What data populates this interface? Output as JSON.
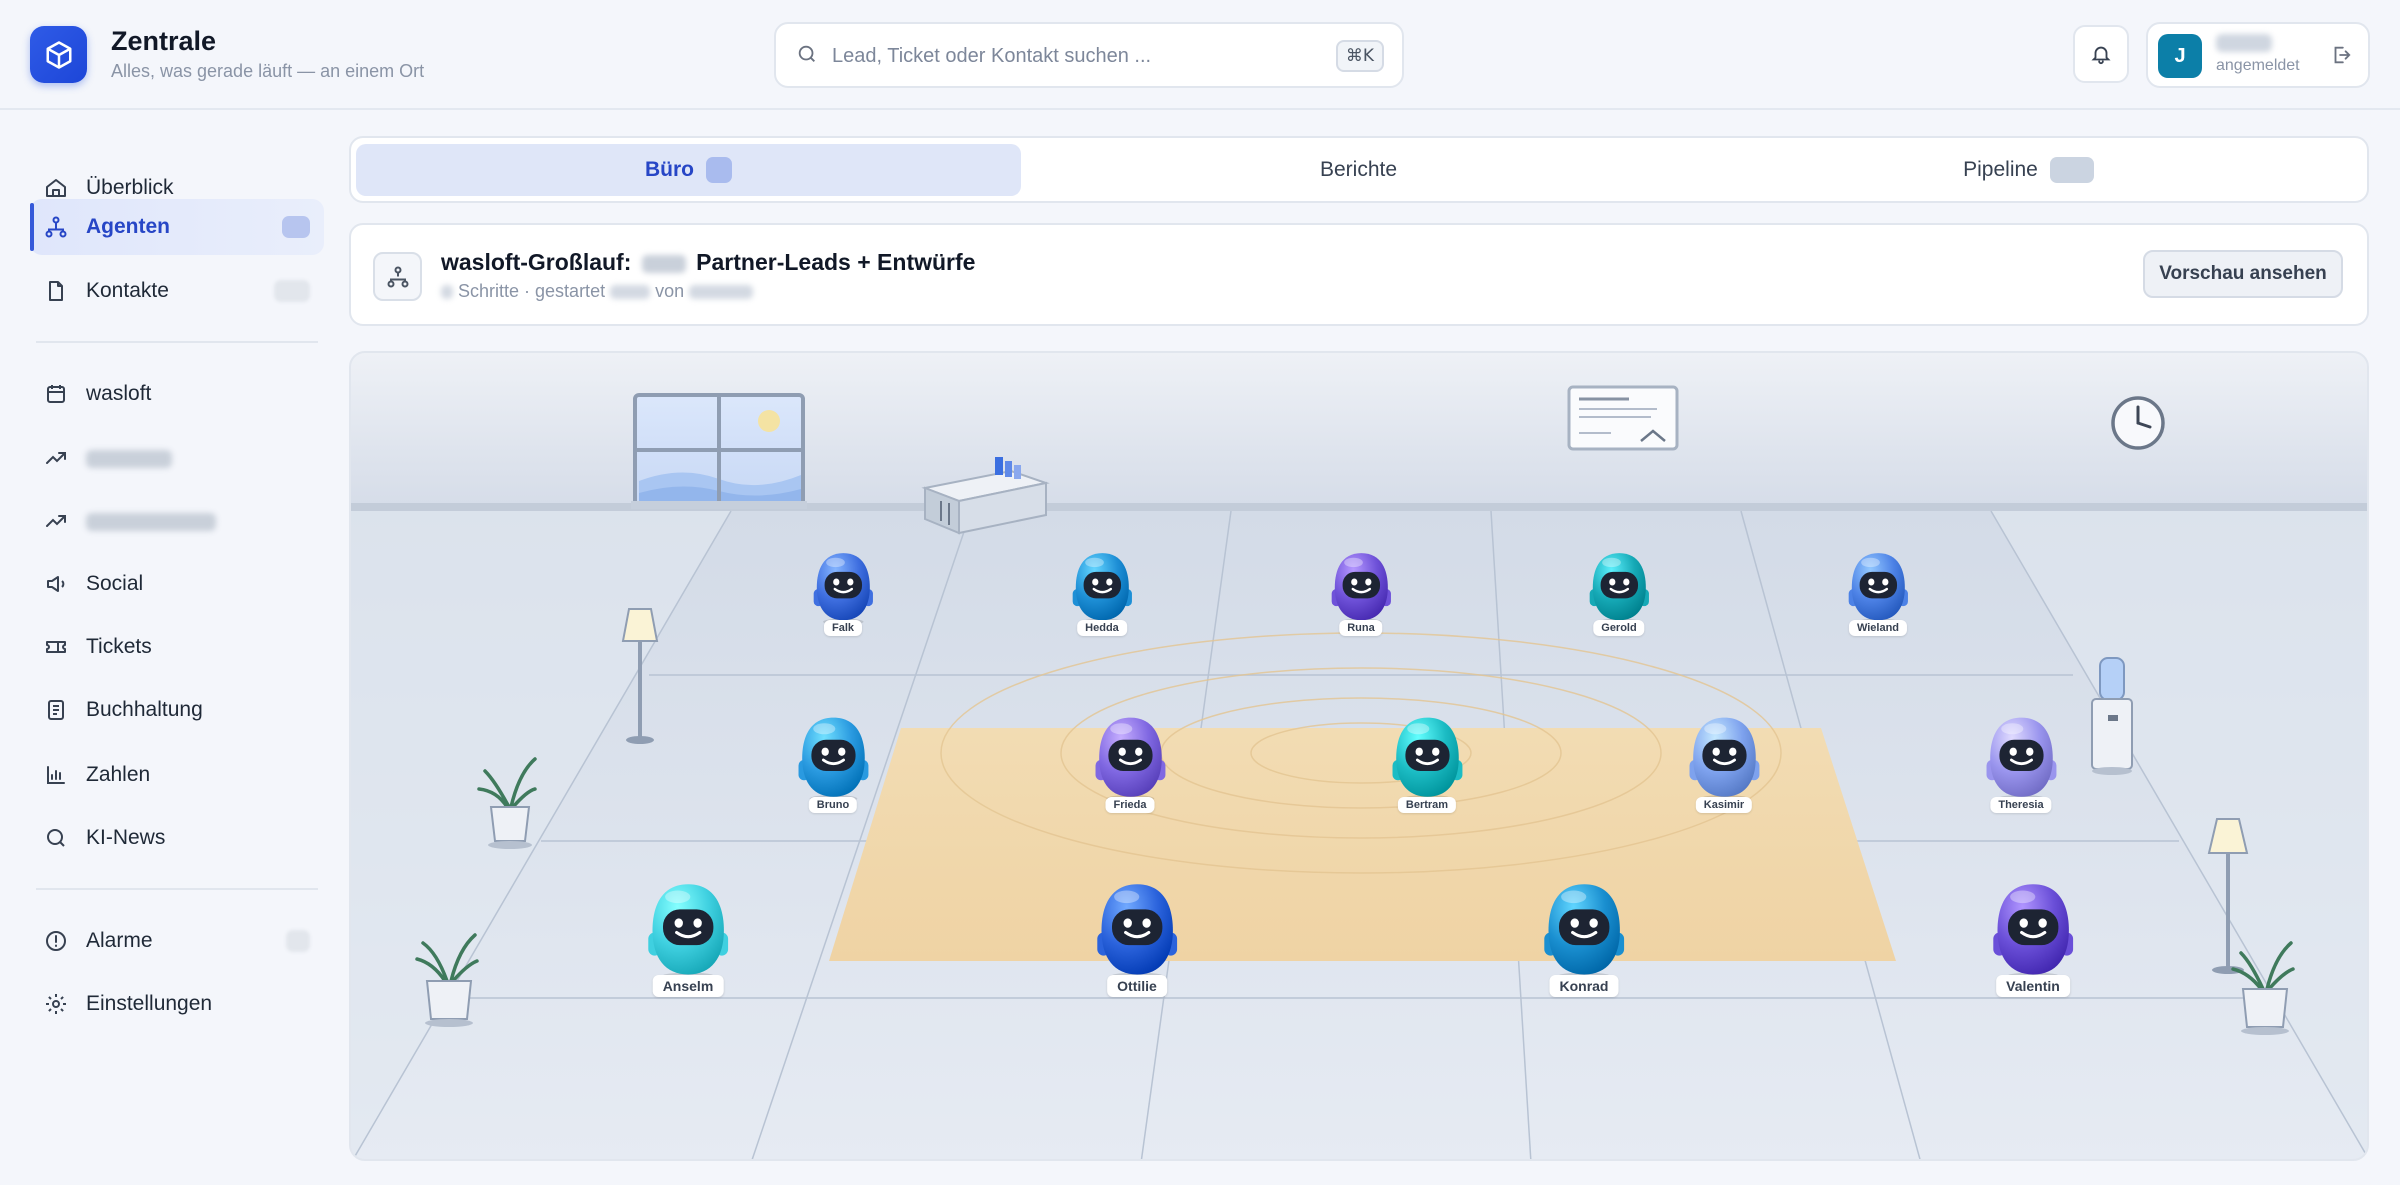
{
  "header": {
    "title": "Zentrale",
    "subtitle": "Alles, was gerade läuft — an einem Ort",
    "search_placeholder": "Lead, Ticket oder Kontakt suchen ...",
    "search_shortcut": "⌘K",
    "user_initial": "J",
    "user_status": "angemeldet"
  },
  "sidebar": {
    "items": [
      {
        "label": "Überblick",
        "icon": "home-icon"
      },
      {
        "label": "Agenten",
        "icon": "network-icon"
      },
      {
        "label": "Kontakte",
        "icon": "file-icon"
      },
      {
        "label": "wasloft",
        "icon": "calendar-icon"
      },
      {
        "label": "Social",
        "icon": "megaphone-icon"
      },
      {
        "label": "Tickets",
        "icon": "ticket-icon"
      },
      {
        "label": "Buchhaltung",
        "icon": "receipt-icon"
      },
      {
        "label": "Zahlen",
        "icon": "bar-chart-icon"
      },
      {
        "label": "KI-News",
        "icon": "search-icon"
      },
      {
        "label": "Alarme",
        "icon": "alert-icon"
      },
      {
        "label": "Einstellungen",
        "icon": "gear-icon"
      }
    ]
  },
  "tabs": [
    {
      "label": "Büro"
    },
    {
      "label": "Berichte"
    },
    {
      "label": "Pipeline"
    }
  ],
  "run": {
    "title_prefix": "wasloft-Großlauf:",
    "title_suffix": "Partner-Leads + Entwürfe",
    "meta_steps": "Schritte · gestartet",
    "meta_by": "von",
    "preview_label": "Vorschau ansehen"
  },
  "agents": [
    {
      "name": "Falk",
      "color": "#3f6fe0"
    },
    {
      "name": "Hedda",
      "color": "#1e8fd6"
    },
    {
      "name": "Runa",
      "color": "#6f52d9"
    },
    {
      "name": "Gerold",
      "color": "#16a9b6"
    },
    {
      "name": "Wieland",
      "color": "#4d82e6"
    },
    {
      "name": "Bruno",
      "color": "#2a9ae0"
    },
    {
      "name": "Frieda",
      "color": "#8068e2"
    },
    {
      "name": "Bertram",
      "color": "#1cbcc4"
    },
    {
      "name": "Kasimir",
      "color": "#7ea2ee"
    },
    {
      "name": "Theresia",
      "color": "#9a95ee"
    },
    {
      "name": "Anselm",
      "color": "#3fd0e0"
    },
    {
      "name": "Ottilie",
      "color": "#2b63dc"
    },
    {
      "name": "Konrad",
      "color": "#1a8fd0"
    },
    {
      "name": "Valentin",
      "color": "#6a4fd8"
    }
  ]
}
